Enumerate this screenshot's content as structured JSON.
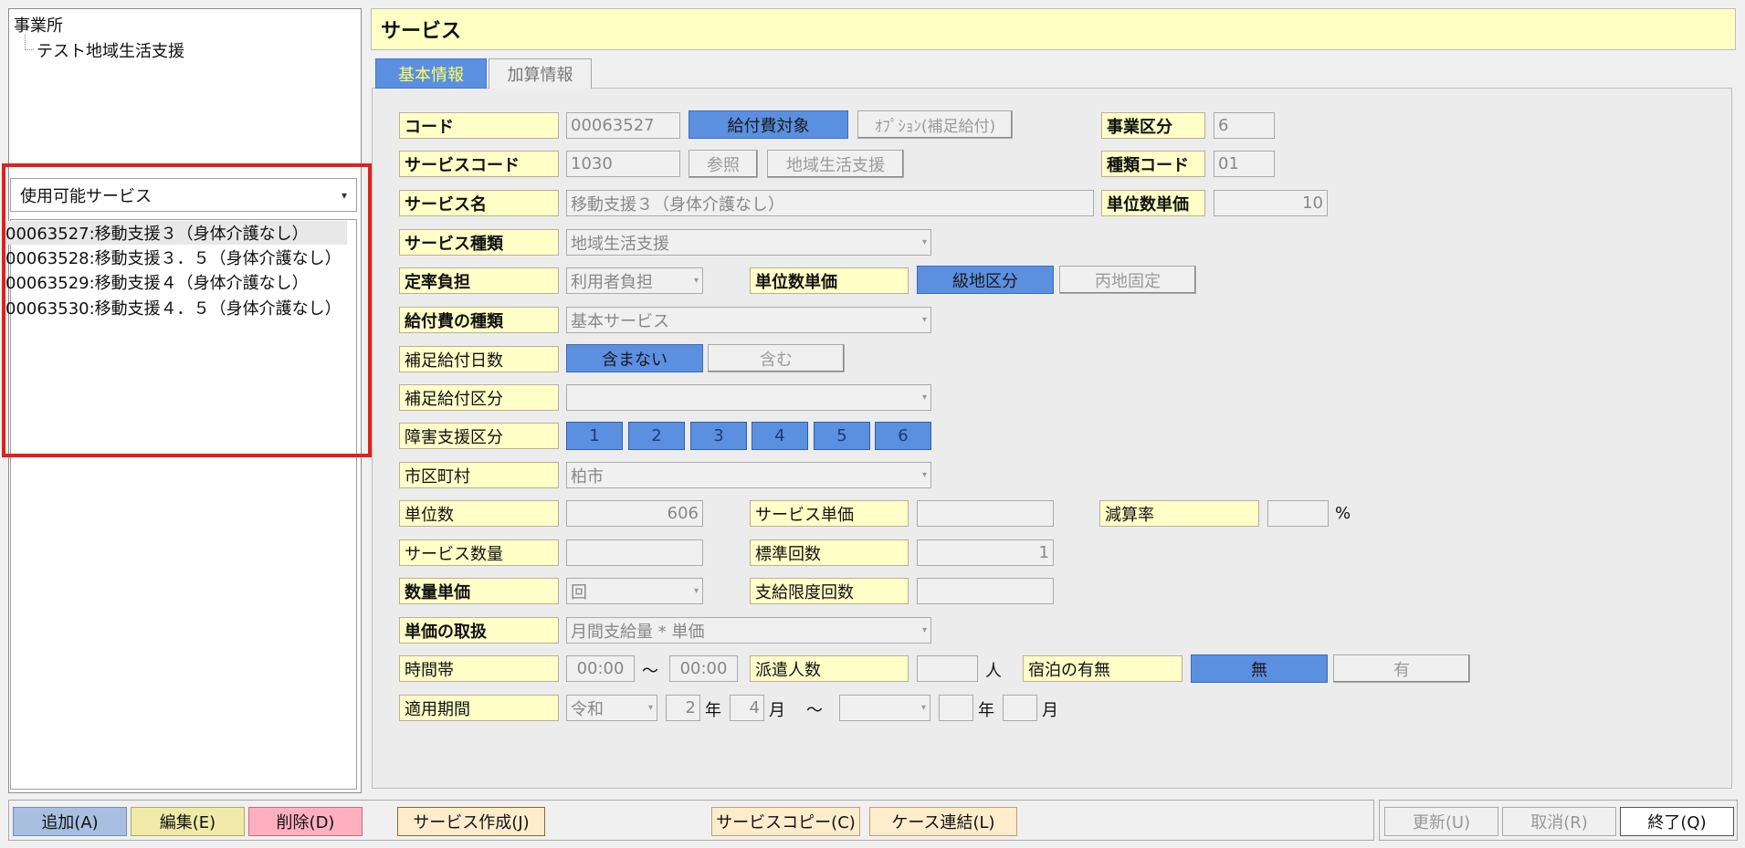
{
  "tree": {
    "root": "事業所",
    "child": "テスト地域生活支援"
  },
  "service_list": {
    "filter": "使用可能サービス",
    "items": [
      "00063527:移動支援３（身体介護なし）",
      "00063528:移動支援３．５（身体介護なし）",
      "00063529:移動支援４（身体介護なし）",
      "00063530:移動支援４．５（身体介護なし）"
    ]
  },
  "title": "サービス",
  "tabs": [
    "基本情報",
    "加算情報"
  ],
  "form": {
    "code_label": "コード",
    "code": "00063527",
    "btn_kyufuhi": "給付費対象",
    "btn_option": "ｵﾌﾟｼｮﾝ(補足給付)",
    "jigyo_kubun_label": "事業区分",
    "jigyo_kubun": "6",
    "service_code_label": "サービスコード",
    "service_code": "1030",
    "btn_sansho": "参照",
    "btn_chiiki": "地域生活支援",
    "shurui_code_label": "種類コード",
    "shurui_code": "01",
    "service_name_label": "サービス名",
    "service_name": "移動支援３（身体介護なし）",
    "tanisu_tanka_label": "単位数単価",
    "tanisu_tanka": "10",
    "service_shurui_label": "サービス種類",
    "service_shurui": "地域生活支援",
    "teiritsu_label": "定率負担",
    "teiritsu": "利用者負担",
    "tanisu_tanka2_label": "単位数単価",
    "btn_kyuchi": "級地区分",
    "btn_heichi": "丙地固定",
    "kyufuhi_shurui_label": "給付費の種類",
    "kyufuhi_shurui": "基本サービス",
    "hosoku_nissu_label": "補足給付日数",
    "btn_fukumanai": "含まない",
    "btn_fukumu": "含む",
    "hosoku_kubun_label": "補足給付区分",
    "hosoku_kubun": "",
    "shogai_label": "障害支援区分",
    "shogai_buttons": [
      "1",
      "2",
      "3",
      "4",
      "5",
      "6"
    ],
    "shikuchoson_label": "市区町村",
    "shikuchoson": "柏市",
    "tanisu_label": "単位数",
    "tanisu": "606",
    "service_tanka_label": "サービス単価",
    "service_tanka": "",
    "gensan_label": "減算率",
    "gensan": "",
    "percent": "%",
    "service_suryo_label": "サービス数量",
    "service_suryo": "",
    "hyojun_label": "標準回数",
    "hyojun": "1",
    "suryo_tanka_label": "数量単価",
    "suryo_tanka": "回",
    "shikyu_label": "支給限度回数",
    "shikyu": "",
    "tanka_toriatsukai_label": "単価の取扱",
    "tanka_toriatsukai": "月間支給量 * 単価",
    "jikantai_label": "時間帯",
    "time_from": "00:00",
    "tilde": "〜",
    "time_to": "00:00",
    "haken_label": "派遣人数",
    "haken": "",
    "nin": "人",
    "shukuhaku_label": "宿泊の有無",
    "btn_nashi": "無",
    "btn_ari": "有",
    "tekiyo_label": "適用期間",
    "era": "令和",
    "year": "2",
    "nen": "年",
    "month": "4",
    "gatsu": "月",
    "tilde2": "〜",
    "era2": "",
    "year2": "",
    "nen2": "年",
    "month2": "",
    "gatsu2": "月"
  },
  "buttons": {
    "add": "追加(A)",
    "edit": "編集(E)",
    "delete": "削除(D)",
    "create": "サービス作成(J)",
    "copy": "サービスコピー(C)",
    "link": "ケース連結(L)",
    "update": "更新(U)",
    "cancel": "取消(R)",
    "exit": "終了(Q)"
  },
  "colors": {
    "accent": "#5b8fe0",
    "label_bg": "#ffffc8",
    "title_bg": "#ffffc4",
    "highlight": "#e02020"
  }
}
